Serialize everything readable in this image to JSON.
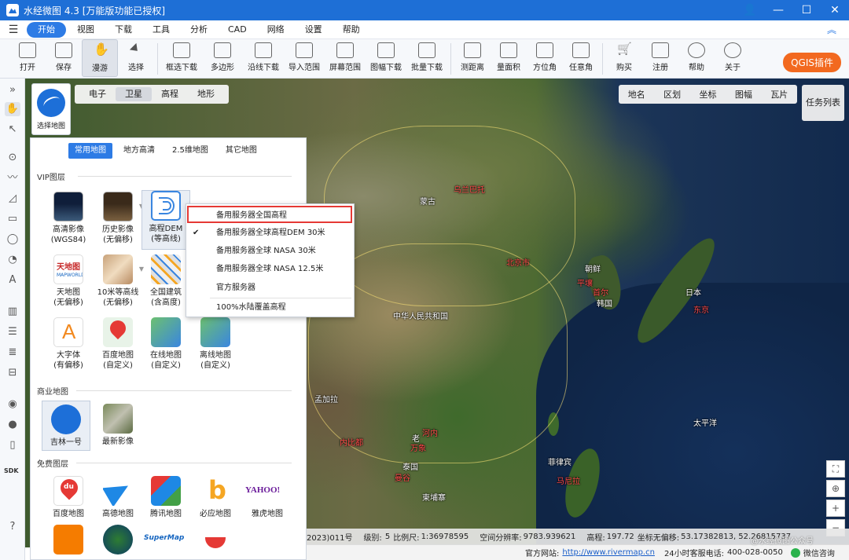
{
  "window": {
    "title": "水经微图 4.3 [万能版功能已授权]"
  },
  "menu": {
    "items": [
      "开始",
      "视图",
      "下载",
      "工具",
      "分析",
      "CAD",
      "网络",
      "设置",
      "帮助"
    ],
    "active_index": 0
  },
  "ribbon": {
    "buttons": [
      "打开",
      "保存",
      "漫游",
      "选择",
      "框选下载",
      "多边形",
      "沿线下载",
      "导入范围",
      "屏幕范围",
      "图幅下载",
      "批量下载",
      "测距离",
      "量面积",
      "方位角",
      "任意角",
      "购买",
      "注册",
      "帮助",
      "关于"
    ],
    "pressed": "漫游",
    "qgis": "QGIS插件"
  },
  "map_tabs": {
    "items": [
      "电子",
      "卫星",
      "高程",
      "地形"
    ],
    "active": "卫星"
  },
  "right_tabs": [
    "地名",
    "区划",
    "坐标",
    "图幅",
    "瓦片"
  ],
  "task_list": "任务列表",
  "selector": {
    "label": "选择地图"
  },
  "panel": {
    "category_tabs": [
      "常用地图",
      "地方高清",
      "2.5维地图",
      "其它地图"
    ],
    "sections": {
      "vip": "VIP图层",
      "commercial": "商业地图",
      "free": "免费图层"
    },
    "vip_tiles": [
      {
        "l1": "高清影像",
        "l2": "(WGS84)"
      },
      {
        "l1": "历史影像",
        "l2": "(无偏移)"
      },
      {
        "l1": "高程DEM",
        "l2": "(等高线)"
      },
      {
        "l1": "天地图",
        "l2": "(无偏移)"
      },
      {
        "l1": "10米等高线",
        "l2": "(无偏移)"
      },
      {
        "l1": "全国建筑",
        "l2": "(含高度)"
      },
      {
        "l1": "大字体",
        "l2": "(有偏移)"
      },
      {
        "l1": "百度地图",
        "l2": "(自定义)"
      },
      {
        "l1": "在线地图",
        "l2": "(自定义)"
      },
      {
        "l1": "离线地图",
        "l2": "(自定义)"
      }
    ],
    "commercial_tiles": [
      {
        "l1": "吉林一号"
      },
      {
        "l1": "最新影像"
      }
    ],
    "free_tiles": [
      {
        "l1": "百度地图"
      },
      {
        "l1": "高德地图"
      },
      {
        "l1": "腾讯地图"
      },
      {
        "l1": "必应地图"
      },
      {
        "l1": "雅虎地图"
      }
    ],
    "tile_badges": {
      "tianditu": "天地图",
      "yahoo": "YAHOO!",
      "supermap": "SuperMap",
      "du": "du"
    }
  },
  "dropdown": {
    "options": [
      "备用服务器全国高程",
      "备用服务器全球高程DEM 30米",
      "备用服务器全球 NASA 30米",
      "备用服务器全球 NASA 12.5米",
      "官方服务器",
      "100%水陆覆盖高程"
    ],
    "checked_index": 1,
    "highlight_index": 0,
    "check_mark": "✔"
  },
  "map_labels": [
    {
      "text": "蒙古",
      "red": false
    },
    {
      "text": "乌兰巴托",
      "red": true
    },
    {
      "text": "北京市",
      "red": true
    },
    {
      "text": "朝鲜",
      "red": false
    },
    {
      "text": "平壤",
      "red": true
    },
    {
      "text": "韩国",
      "red": false
    },
    {
      "text": "首尔",
      "red": true
    },
    {
      "text": "日本",
      "red": false
    },
    {
      "text": "东京",
      "red": true
    },
    {
      "text": "中华人民共和国",
      "red": false
    },
    {
      "text": "太平洋",
      "red": false
    },
    {
      "text": "孟加拉",
      "red": false
    },
    {
      "text": "内比都",
      "red": true
    },
    {
      "text": "河内",
      "red": true
    },
    {
      "text": "老",
      "red": false
    },
    {
      "text": "万象",
      "red": true
    },
    {
      "text": "泰国",
      "red": false
    },
    {
      "text": "曼谷",
      "red": true
    },
    {
      "text": "柬埔寨",
      "red": false
    },
    {
      "text": "菲律宾",
      "red": false
    },
    {
      "text": "马尼拉",
      "red": true
    }
  ],
  "status": {
    "approval": "2023)011号",
    "level_label": "级别:",
    "level": "5",
    "scale_label": "比例尺:",
    "scale": "1:36978595",
    "resolution_label": "空间分辨率:",
    "resolution": "9783.939621",
    "elevation_label": "高程:",
    "elevation": "197.72",
    "coord_label": "坐标无偏移:",
    "coords": "53.17382813, 52.26815737"
  },
  "footer": {
    "site_label": "官方网站:",
    "site": "http://www.rivermap.cn",
    "hotline_label": "24小时客服电话:",
    "hotline": "400-028-0050",
    "chat": "微信咨询",
    "watermark": "@水经微图公众号"
  },
  "colors": {
    "title_bar": "#1e6fd6",
    "accent": "#2d7be5",
    "qgis": "#f2691f",
    "highlight_border": "#e53935"
  }
}
